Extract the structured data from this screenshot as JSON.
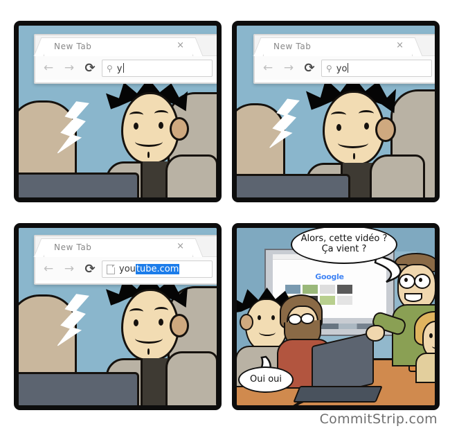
{
  "comic": {
    "title": "CommitStrip comic strip",
    "watermark": "CommitStrip.com",
    "panels": [
      {
        "id": "panel-1",
        "browser": {
          "tab_label": "New Tab",
          "close_icon": "×",
          "back_icon": "←",
          "forward_icon": "→",
          "reload_icon": "⟳",
          "omnibox_icon": "search-icon",
          "omnibox_glyph": "⚲",
          "omnibox_text": "y",
          "omnibox_selected": "",
          "has_page_icon": false
        },
        "caption": "Man typing the letter y into a new browser tab"
      },
      {
        "id": "panel-2",
        "browser": {
          "tab_label": "New Tab",
          "close_icon": "×",
          "back_icon": "←",
          "forward_icon": "→",
          "reload_icon": "⟳",
          "omnibox_icon": "search-icon",
          "omnibox_glyph": "⚲",
          "omnibox_text": "yo",
          "omnibox_selected": "",
          "has_page_icon": false
        },
        "caption": "Man typing yo into a new browser tab"
      },
      {
        "id": "panel-3",
        "browser": {
          "tab_label": "New Tab",
          "close_icon": "×",
          "back_icon": "←",
          "forward_icon": "→",
          "reload_icon": "⟳",
          "omnibox_icon": "page-icon",
          "omnibox_glyph": "",
          "omnibox_text": "you",
          "omnibox_selected": "tube.com",
          "has_page_icon": true
        },
        "caption": "Autocomplete fills in youtube.com highlighted in blue"
      },
      {
        "id": "panel-4",
        "speech": {
          "presenter_line1": "Alors, cette vidéo ?",
          "presenter_line2": "Ça vient ?",
          "developer_line": "Oui oui"
        },
        "projection": {
          "logo_text": "Google"
        },
        "caption": "Meeting room: colleague asks about the video while devs browse"
      }
    ],
    "colors": {
      "panel_border": "#0d0d0d",
      "background_blue": "#8ab6cc",
      "skin": "#f2dcb3",
      "hair": "#050505",
      "jacket": "#b9b2a4",
      "desk": "#d08a4e",
      "selection_blue": "#1b7cea",
      "wall_blue": "#7fa9c0",
      "screen_grey": "#c8ccd2",
      "green_shirt": "#8aa054",
      "red_hoodie": "#b2553f",
      "watermark": "#6f6f6f"
    }
  }
}
